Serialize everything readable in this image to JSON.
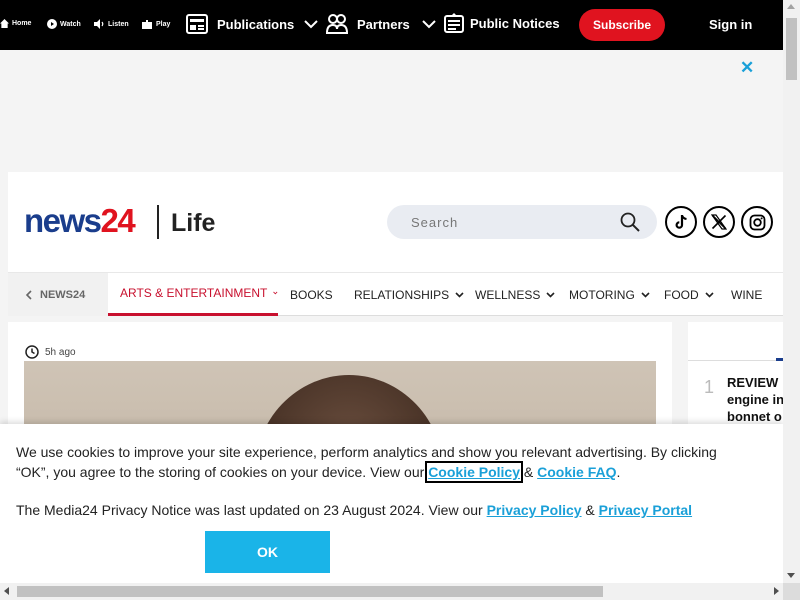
{
  "topbar": {
    "home_label": "Home",
    "watch_label": "Watch",
    "listen_label": "Listen",
    "play_label": "Play",
    "publications_label": "Publications",
    "partners_label": "Partners",
    "public_notices_label": "Public Notices",
    "subscribe_label": "Subscribe",
    "signin_label": "Sign in"
  },
  "ad": {
    "close_label": "✕"
  },
  "header": {
    "logo_news": "news",
    "logo_24": "24",
    "section_title": "Life",
    "search_placeholder": "Search"
  },
  "nav": {
    "back_label": "NEWS24",
    "items": [
      {
        "label": "ARTS & ENTERTAINMENT"
      },
      {
        "label": "BOOKS"
      },
      {
        "label": "RELATIONSHIPS"
      },
      {
        "label": "WELLNESS"
      },
      {
        "label": "MOTORING"
      },
      {
        "label": "FOOD"
      },
      {
        "label": "WINE"
      }
    ]
  },
  "article": {
    "time_ago": "5h ago"
  },
  "sidebar": {
    "rank": "1",
    "headline_line1": "REVIEW",
    "headline_line2": "engine in",
    "headline_line3": "bonnet o"
  },
  "cookie": {
    "text_part1": "We use cookies to improve your site experience, perform analytics and show you relevant advertising. By clicking “OK”, you agree to the storing of cookies on your device. View our ",
    "cookie_policy_link": "Cookie Policy",
    "amp1": " & ",
    "cookie_faq_link": "Cookie FAQ",
    "period": ".",
    "privacy_text": "The Media24 Privacy Notice was last updated on 23 August 2024. View our ",
    "privacy_policy_link": "Privacy Policy",
    "amp2": " & ",
    "privacy_portal_link": "Privacy Portal",
    "ok_label": "OK"
  },
  "colors": {
    "brand_blue": "#1a3d8c",
    "brand_red": "#e0131f",
    "link_blue": "#1aa0d8",
    "ok_button": "#1ab4e8"
  }
}
